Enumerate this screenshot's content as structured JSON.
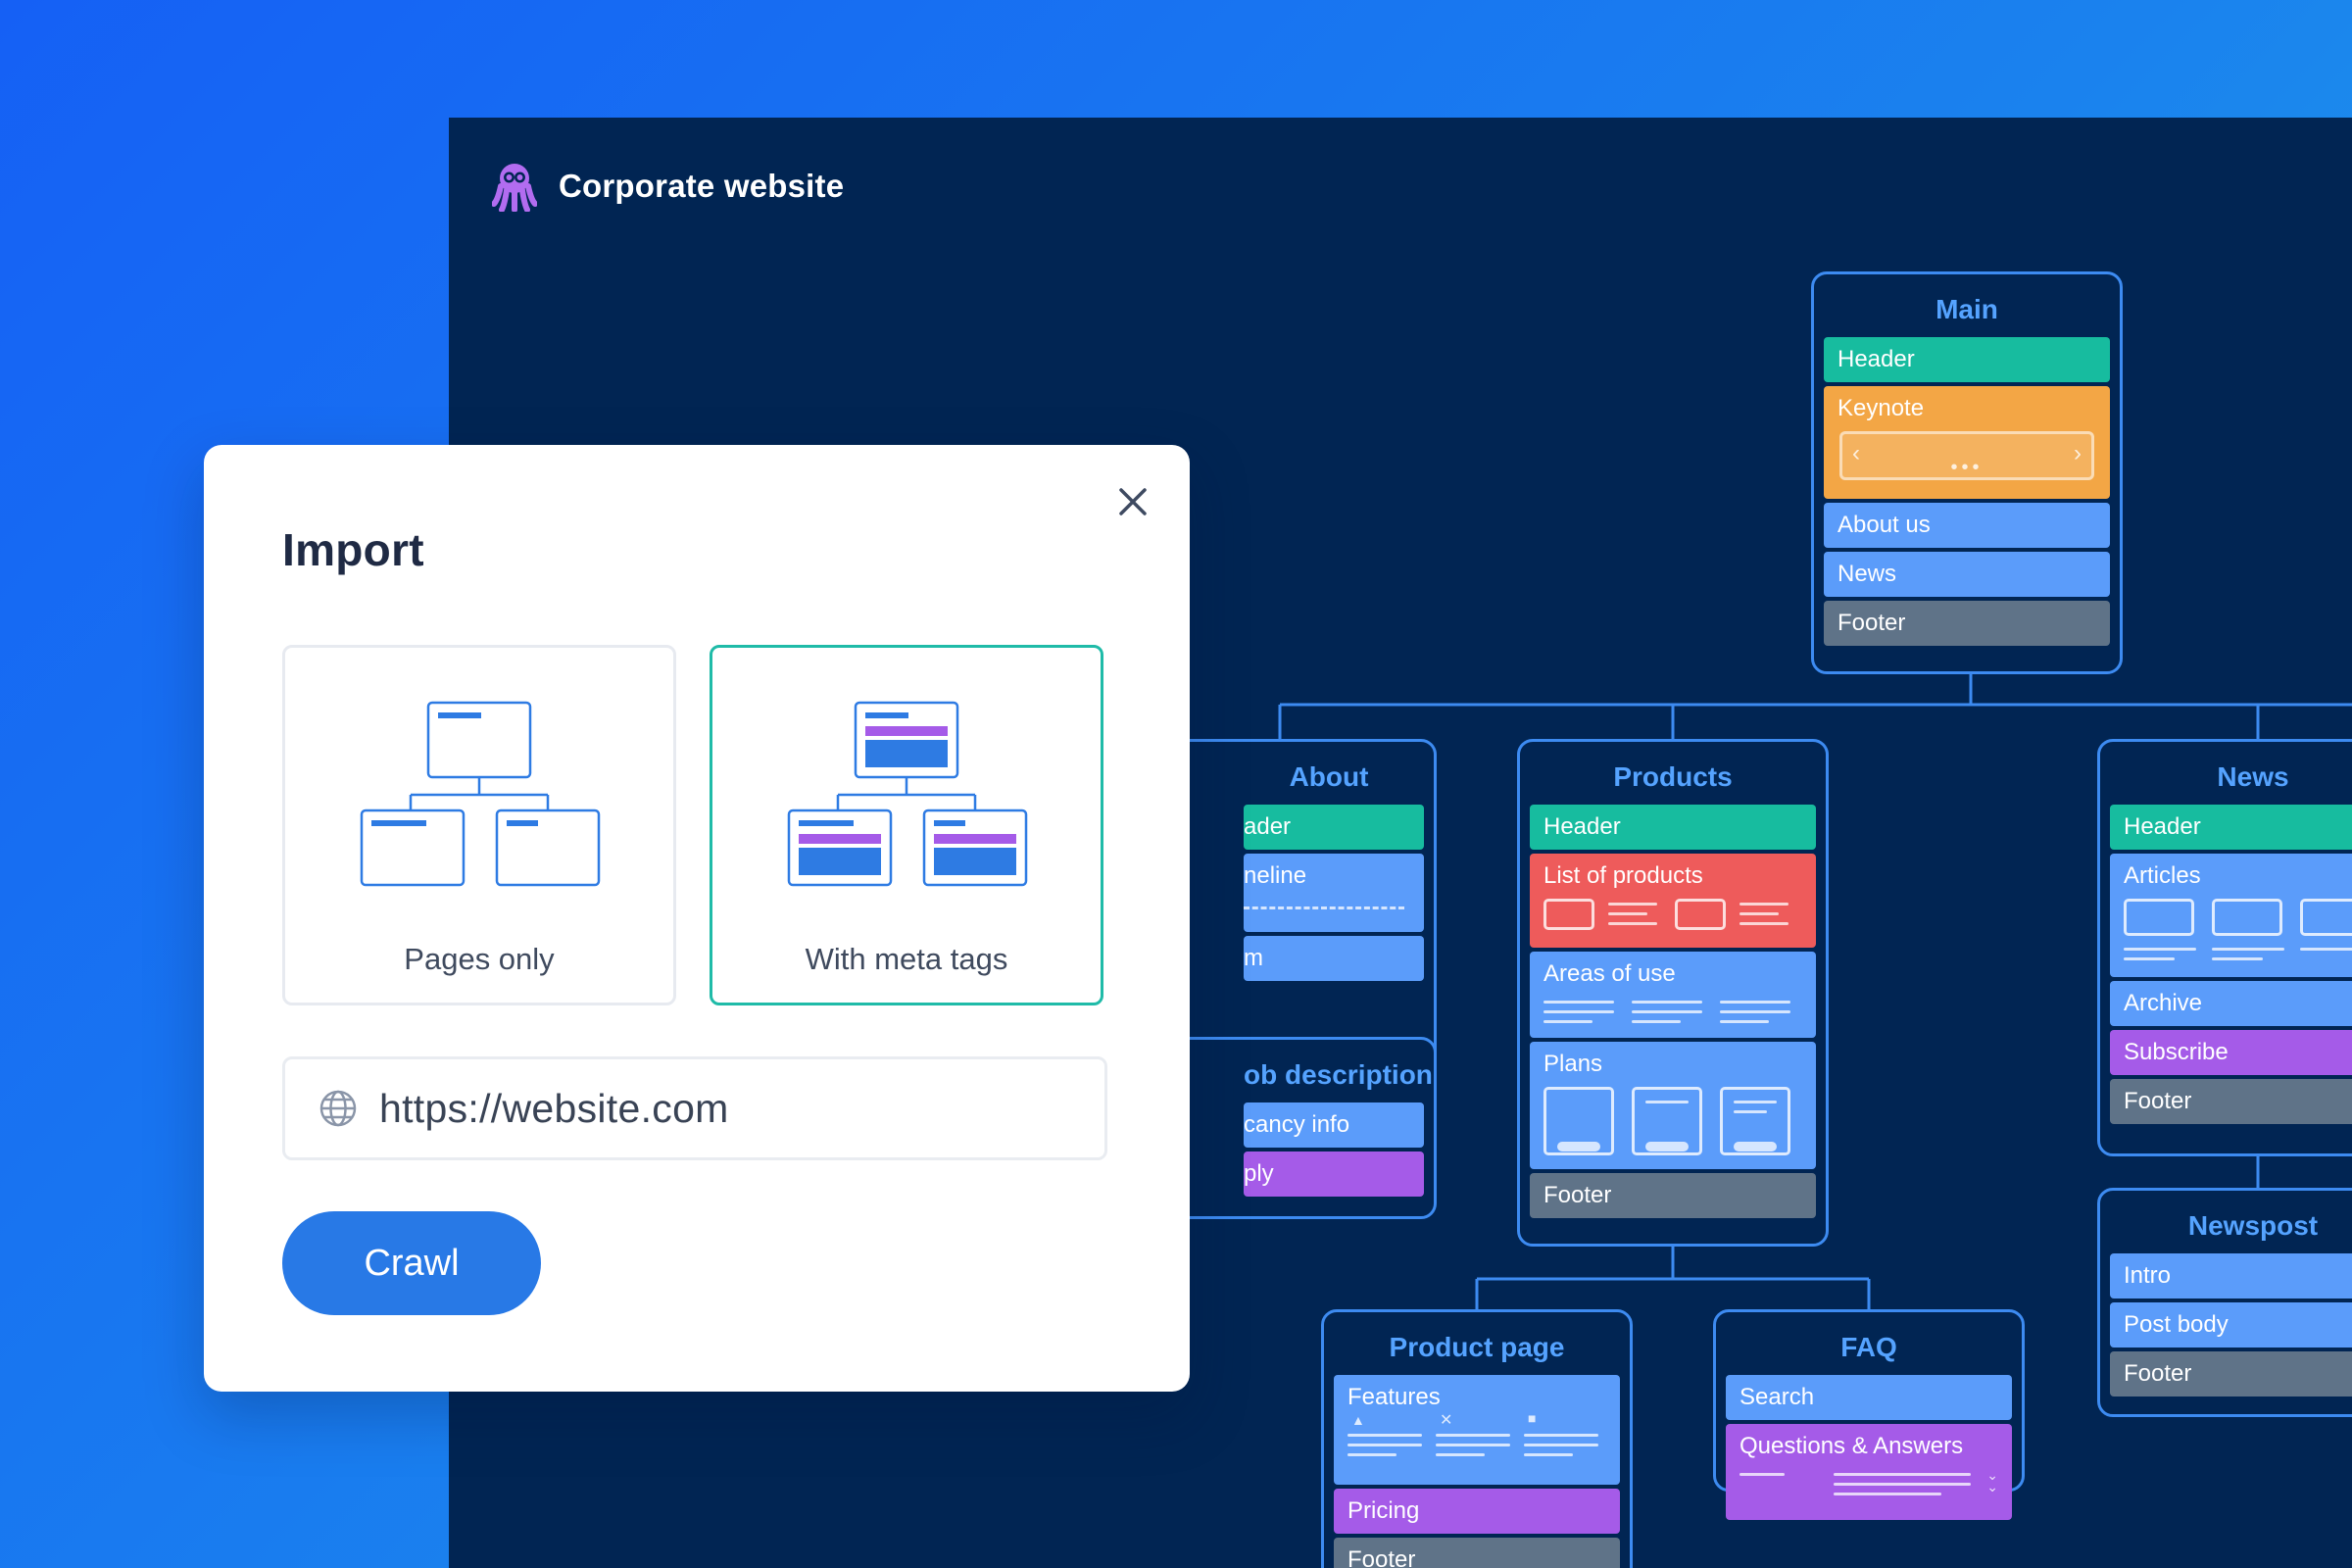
{
  "app": {
    "title": "Corporate website",
    "logo_icon": "octopus-logo-icon"
  },
  "sitemap": {
    "main": {
      "title": "Main",
      "blocks": [
        "Header",
        "Keynote",
        "About us",
        "News",
        "Footer"
      ]
    },
    "about": {
      "title": "About",
      "blocks": [
        "ader",
        "neline",
        "m"
      ]
    },
    "job_description": {
      "title": "ob description",
      "blocks": [
        "cancy info",
        "ply"
      ]
    },
    "products": {
      "title": "Products",
      "blocks": [
        "Header",
        "List of products",
        "Areas of use",
        "Plans",
        "Footer"
      ]
    },
    "news": {
      "title": "News",
      "blocks": [
        "Header",
        "Articles",
        "Archive",
        "Subscribe",
        "Footer"
      ]
    },
    "newspost": {
      "title": "Newspost",
      "blocks": [
        "Intro",
        "Post body",
        "Footer"
      ]
    },
    "product_page": {
      "title": "Product page",
      "blocks": [
        "Features",
        "Pricing",
        "Footer"
      ]
    },
    "faq": {
      "title": "FAQ",
      "blocks": [
        "Search",
        "Questions & Answers"
      ]
    }
  },
  "modal": {
    "title": "Import",
    "options": [
      {
        "label": "Pages only",
        "selected": false
      },
      {
        "label": "With meta tags",
        "selected": true
      }
    ],
    "url_value": "https://website.com",
    "crawl_label": "Crawl"
  },
  "colors": {
    "canvas": "#012553",
    "node_border": "#3d8bf1",
    "teal": "#17bc9f",
    "orange": "#f3a645",
    "blue": "#5b9cfa",
    "gray": "#5f7388",
    "red": "#ee5b5b",
    "purple": "#a55be8",
    "selected_border": "#1fbba8",
    "button": "#2879e6"
  }
}
